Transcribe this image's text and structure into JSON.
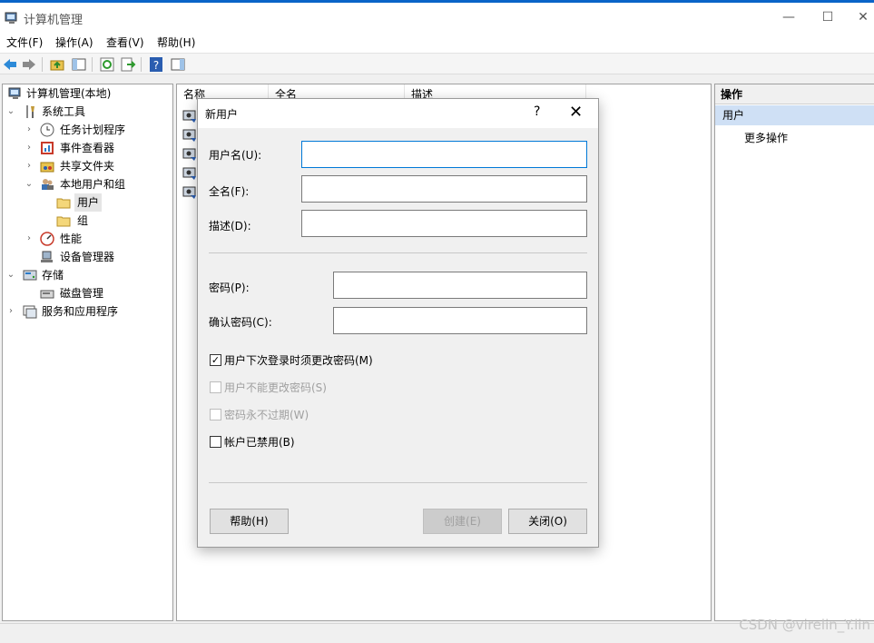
{
  "window": {
    "title": "计算机管理",
    "minimize": "—",
    "maximize": "☐",
    "close": "✕"
  },
  "menu": [
    "文件(F)",
    "操作(A)",
    "查看(V)",
    "帮助(H)"
  ],
  "tree": [
    {
      "label": "计算机管理(本地)",
      "icon": "computer-icon"
    },
    {
      "label": "系统工具",
      "icon": "tools-icon",
      "arrow": "⌄"
    },
    {
      "label": "任务计划程序",
      "icon": "clock-icon",
      "arrow": "›"
    },
    {
      "label": "事件查看器",
      "icon": "event-viewer-icon",
      "arrow": "›"
    },
    {
      "label": "共享文件夹",
      "icon": "shared-folder-icon",
      "arrow": "›"
    },
    {
      "label": "本地用户和组",
      "icon": "users-group-icon",
      "arrow": "⌄"
    },
    {
      "label": "用户",
      "icon": "folder-icon"
    },
    {
      "label": "组",
      "icon": "folder-icon"
    },
    {
      "label": "性能",
      "icon": "performance-icon",
      "arrow": "›"
    },
    {
      "label": "设备管理器",
      "icon": "device-manager-icon"
    },
    {
      "label": "存储",
      "icon": "storage-icon",
      "arrow": "⌄"
    },
    {
      "label": "磁盘管理",
      "icon": "disk-icon"
    },
    {
      "label": "服务和应用程序",
      "icon": "services-icon",
      "arrow": "›"
    }
  ],
  "list": {
    "columns": [
      "名称",
      "全名",
      "描述"
    ]
  },
  "actions": {
    "header": "操作",
    "section": "用户",
    "more": "更多操作"
  },
  "dialog": {
    "title": "新用户",
    "help_glyph": "?",
    "close_glyph": "✕",
    "username_label": "用户名(U):",
    "fullname_label": "全名(F):",
    "description_label": "描述(D):",
    "password_label": "密码(P):",
    "confirm_label": "确认密码(C):",
    "username_value": "",
    "fullname_value": "",
    "description_value": "",
    "password_value": "",
    "confirm_value": "",
    "checkboxes": [
      {
        "label": "用户下次登录时须更改密码(M)",
        "checked": true,
        "enabled": true
      },
      {
        "label": "用户不能更改密码(S)",
        "checked": false,
        "enabled": false
      },
      {
        "label": "密码永不过期(W)",
        "checked": false,
        "enabled": false
      },
      {
        "label": "帐户已禁用(B)",
        "checked": false,
        "enabled": true
      }
    ],
    "help_button": "帮助(H)",
    "create_button": "创建(E)",
    "close_button": "关闭(O)"
  },
  "watermark": "CSDN @virelin_Y.lin",
  "colors": {
    "accent": "#0078d7",
    "selection": "#cfe0f5"
  }
}
